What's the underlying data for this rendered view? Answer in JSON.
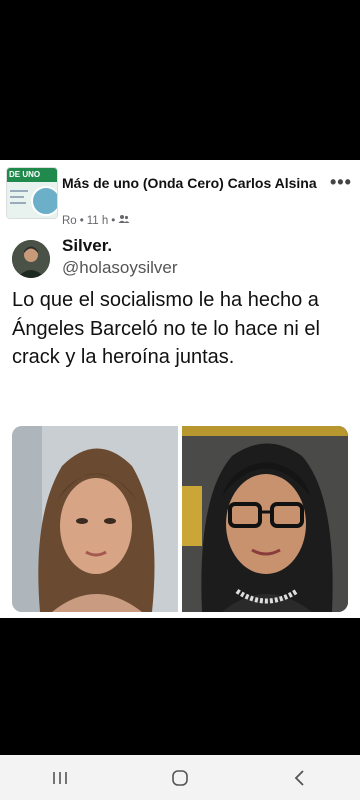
{
  "post": {
    "group_avatar_text": "DE UNO",
    "header_name": "Más de uno (Onda Cero)  Carlos Alsina",
    "meta": {
      "author": "Ro",
      "separator": "•",
      "time": "11 h",
      "separator2": "•"
    },
    "more_label": "•••"
  },
  "tweet": {
    "name": "Silver.",
    "handle": "@holasoysilver",
    "text": "Lo que el socialismo le ha hecho a Ángeles Barceló no te lo hace ni el crack y la heroína juntas."
  },
  "icons": {
    "more": "more-options-icon",
    "audience": "friends-audience-icon",
    "nav_recent": "recent-apps-icon",
    "nav_home": "home-icon",
    "nav_back": "back-icon"
  },
  "colors": {
    "brand_green": "#1f8a4c",
    "nav_bg": "#f3f3f3"
  }
}
